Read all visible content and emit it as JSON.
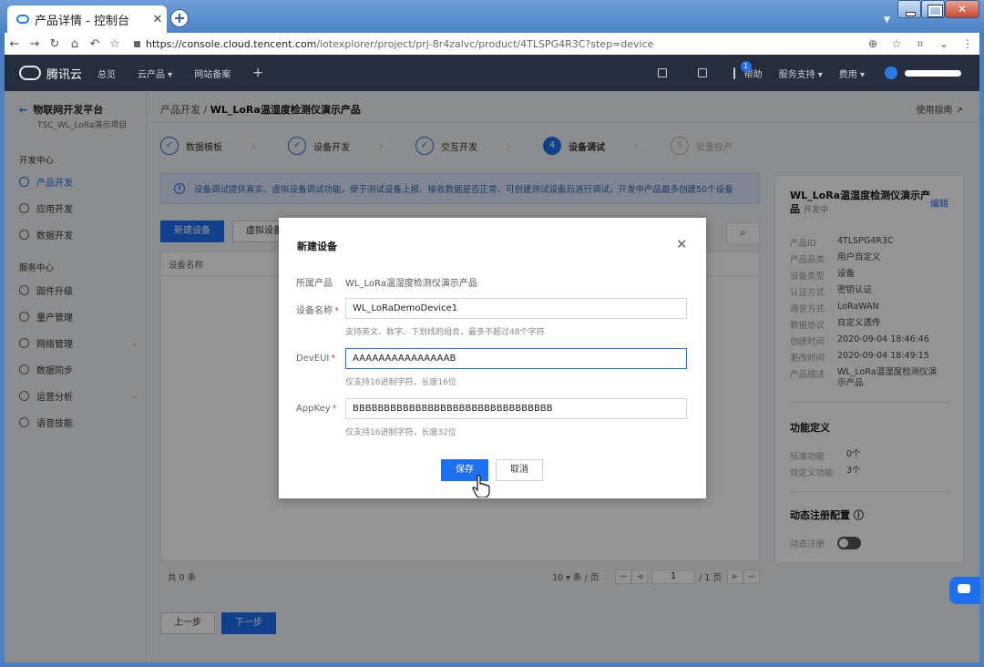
{
  "browser": {
    "tab_title": "产品详情 - 控制台",
    "tab_close": "✕",
    "new_tab": "+",
    "url_host": "https://console.cloud.tencent.com",
    "url_path": "/iotexplorer/project/prj-8r4zalvc/product/4TLSPG4R3C?step=device"
  },
  "header": {
    "logo_text": "腾讯云",
    "nav": [
      "总览",
      "云产品 ▾",
      "网站备案"
    ],
    "plus": "+",
    "mail_badge": "1",
    "help": "帮助",
    "support": "服务支持 ▾",
    "billing": "费用 ▾"
  },
  "sidebar": {
    "back_title": "物联网开发平台",
    "project": "TSC_WL_LoRa演示项目",
    "section_dev": "开发中心",
    "dev_items": [
      "产品开发",
      "应用开发",
      "数据开发"
    ],
    "section_svc": "服务中心",
    "svc_items": [
      "固件升级",
      "量产管理",
      "网络管理",
      "数据同步",
      "运营分析",
      "语音技能"
    ]
  },
  "main": {
    "crumb_root": "产品开发",
    "crumb_sep": "/",
    "crumb_current": "WL_LoRa温湿度检测仪演示产品",
    "guide": "使用指南 ↗",
    "steps": [
      {
        "mark": "✓",
        "label": "数据模板"
      },
      {
        "mark": "✓",
        "label": "设备开发"
      },
      {
        "mark": "✓",
        "label": "交互开发"
      },
      {
        "mark": "4",
        "label": "设备调试"
      },
      {
        "mark": "5",
        "label": "批量投产"
      }
    ],
    "notice_icon": "i",
    "notice": "设备调试提供真实、虚拟设备调试功能，便于测试设备上报、接收数据是否正常，可创建测试设备后进行调试，开发中产品最多创建50个设备",
    "new_device_btn": "新建设备",
    "virtual_device_btn": "虚拟设备",
    "col_device_name": "设备名称",
    "pager_total": "共 0 条",
    "pager_size": "10 ▾ 条 / 页",
    "pager_first": "⏮",
    "pager_prev": "◀",
    "pager_page": "1",
    "pager_of": "/ 1 页",
    "pager_next": "▶",
    "pager_last": "⏭",
    "prev_step": "上一步",
    "next_step": "下一步"
  },
  "panel": {
    "title": "WL_LoRa温湿度检测仪演示产品",
    "status": "开发中",
    "edit": "编辑",
    "props": [
      {
        "k": "产品ID",
        "v": "4TLSPG4R3C"
      },
      {
        "k": "产品品类",
        "v": "用户自定义"
      },
      {
        "k": "设备类型",
        "v": "设备"
      },
      {
        "k": "认证方式",
        "v": "密钥认证"
      },
      {
        "k": "通信方式",
        "v": "LoRaWAN"
      },
      {
        "k": "数据协议",
        "v": "自定义透传"
      },
      {
        "k": "创建时间",
        "v": "2020-09-04 18:46:46"
      },
      {
        "k": "更改时间",
        "v": "2020-09-04 18:49:15"
      },
      {
        "k": "产品描述",
        "v": "WL_LoRa温湿度检测仪演示产品"
      }
    ],
    "func_title": "功能定义",
    "func": [
      {
        "k": "标准功能",
        "v": "0个"
      },
      {
        "k": "自定义功能",
        "v": "3个"
      }
    ],
    "dyn_title": "动态注册配置 ⓘ",
    "dyn_label": "动态注册"
  },
  "modal": {
    "title": "新建设备",
    "close": "✕",
    "product_label": "所属产品",
    "product_value": "WL_LoRa温湿度检测仪演示产品",
    "name_label": "设备名称",
    "name_value": "WL_LoRaDemoDevice1",
    "name_hint": "支持英文、数字、下划线的组合，最多不超过48个字符",
    "deveui_label": "DevEUI",
    "deveui_value": "AAAAAAAAAAAAAAAB",
    "deveui_hint": "仅支持16进制字符，长度16位",
    "appkey_label": "AppKey",
    "appkey_value": "BBBBBBBBBBBBBBBBBBBBBBBBBBBBBBBB",
    "appkey_hint": "仅支持16进制字符，长度32位",
    "required_mark": "*",
    "save": "保存",
    "cancel": "取消"
  },
  "colors": {
    "accent": "#1e6ff0",
    "header_bg": "#262e3d",
    "notice_bg": "#dce8fb"
  }
}
